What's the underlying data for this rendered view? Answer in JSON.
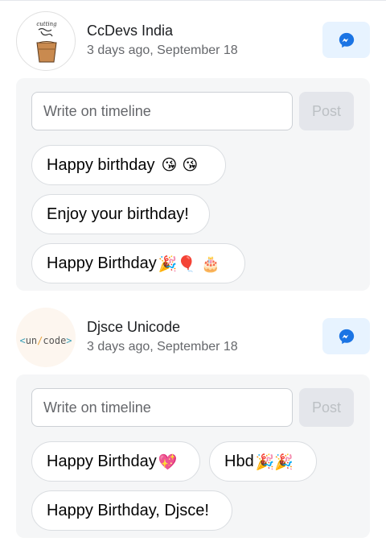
{
  "posts": [
    {
      "name": "CcDevs India",
      "meta": "3 days ago, September 18",
      "avatar_text": "cutting chai",
      "input_placeholder": "Write on timeline",
      "post_label": "Post",
      "wishes": [
        {
          "text": "Happy birthday",
          "emoji": "😘 😘"
        },
        {
          "text": "Enjoy your birthday!",
          "emoji": ""
        },
        {
          "text": "Happy Birthday",
          "emoji": "🎉🎈 🎂"
        }
      ]
    },
    {
      "name": "Djsce Unicode",
      "meta": "3 days ago, September 18",
      "avatar_text": "<un/code>",
      "input_placeholder": "Write on timeline",
      "post_label": "Post",
      "wishes": [
        {
          "text": "Happy Birthday",
          "emoji": "💖"
        },
        {
          "text": "Hbd",
          "emoji": "🎉🎉"
        },
        {
          "text": "Happy Birthday, Djsce!",
          "emoji": ""
        }
      ]
    }
  ],
  "colors": {
    "messenger_blue": "#1b74e4",
    "messenger_bg": "#e7f3ff",
    "panel_bg": "#f5f6f7",
    "secondary_text": "#65676b"
  },
  "icons": {
    "messenger": "messenger-icon"
  }
}
